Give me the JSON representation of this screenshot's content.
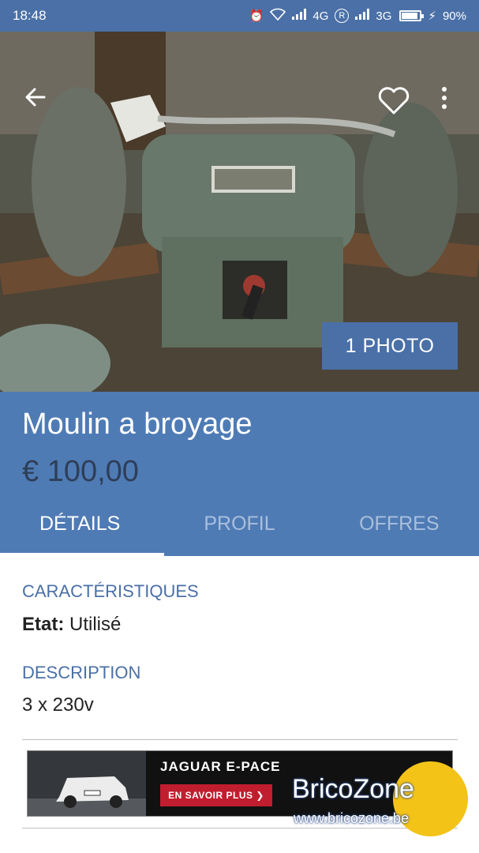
{
  "status_bar": {
    "time": "18:48",
    "network_1": "4G",
    "roaming": "R",
    "network_2": "3G",
    "battery": "90%"
  },
  "listing": {
    "photo_count_label": "1 PHOTO",
    "title": "Moulin a broyage",
    "price": "€ 100,00"
  },
  "tabs": [
    {
      "label": "DÉTAILS",
      "active": true
    },
    {
      "label": "PROFIL",
      "active": false
    },
    {
      "label": "OFFRES",
      "active": false
    }
  ],
  "details": {
    "characteristics_heading": "CARACTÉRISTIQUES",
    "condition_key": "Etat:",
    "condition_value": "Utilisé",
    "description_heading": "DESCRIPTION",
    "description_text": "3 x 230v"
  },
  "ad": {
    "title": "JAGUAR E-PACE",
    "cta": "EN SAVOIR PLUS ❯"
  },
  "watermark": {
    "brand": "BricoZone",
    "url": "www.bricozone.be"
  },
  "icons": {
    "back": "arrow-left-icon",
    "favorite": "heart-icon",
    "menu": "more-vertical-icon"
  },
  "colors": {
    "primary": "#4a70a7",
    "header": "#4f7bb5",
    "price": "#2e3e57",
    "ad_cta": "#c01e2f",
    "watermark_badge": "#f3c318"
  }
}
